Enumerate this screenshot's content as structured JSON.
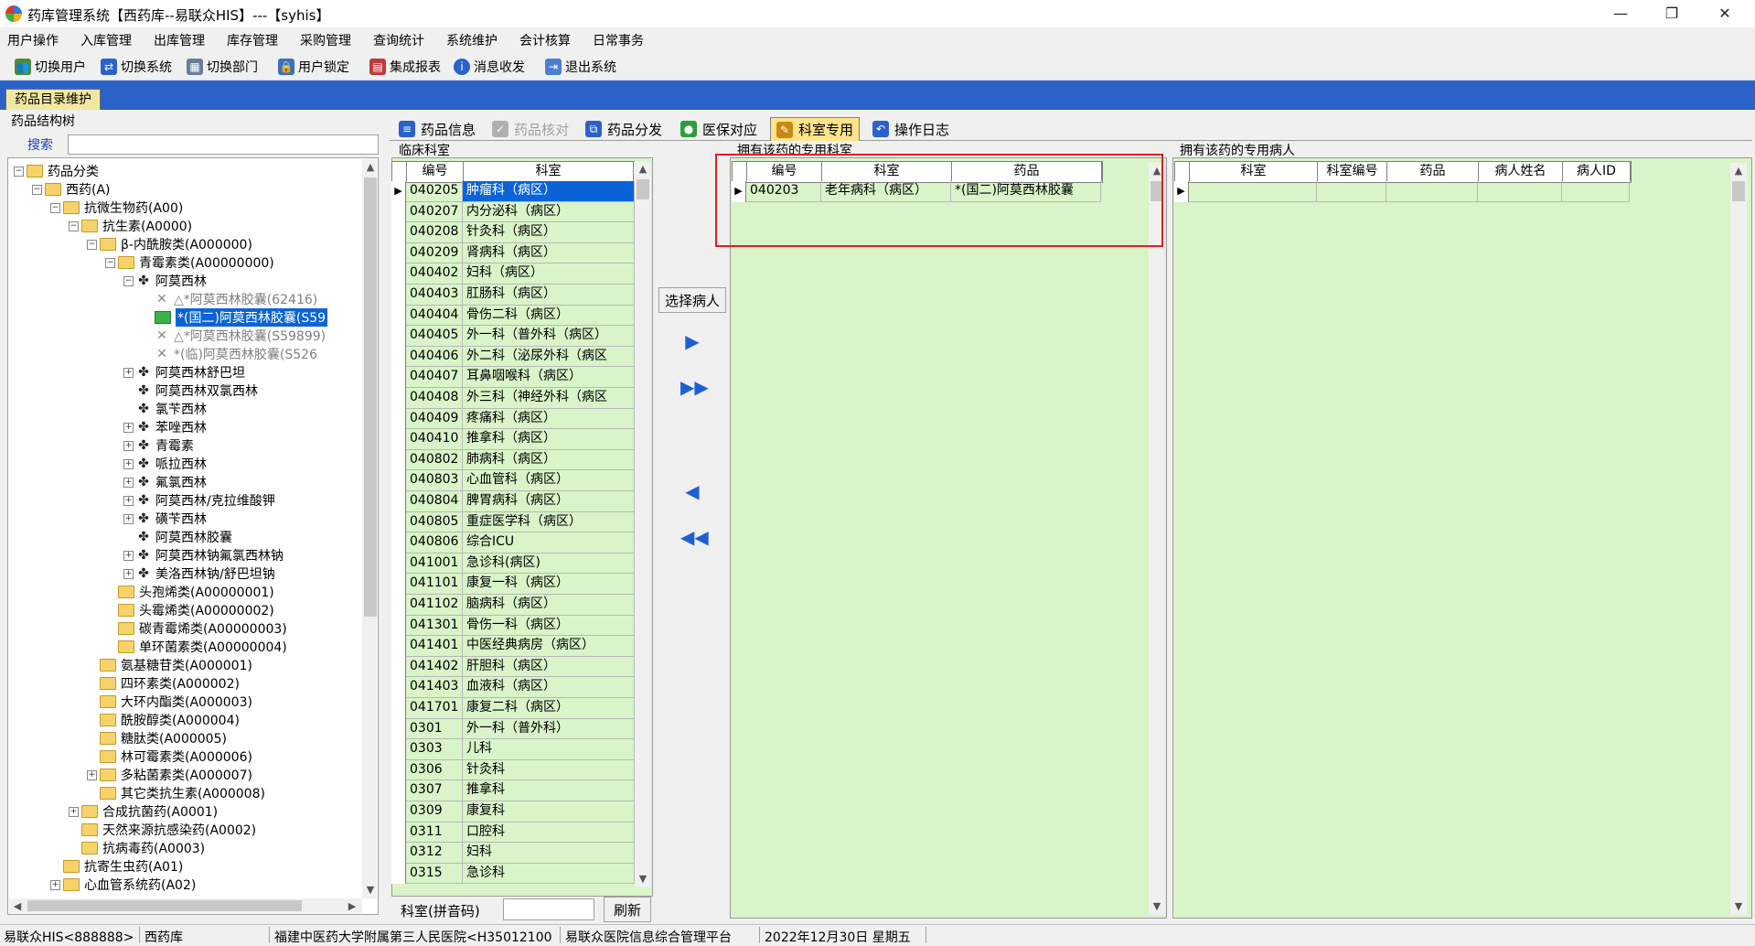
{
  "window": {
    "title": "药库管理系统【西药库--易联众HIS】---【syhis】",
    "minimize": "—",
    "restore": "❐",
    "close": "✕"
  },
  "menu": [
    "用户操作",
    "入库管理",
    "出库管理",
    "库存管理",
    "采购管理",
    "查询统计",
    "系统维护",
    "会计核算",
    "日常事务"
  ],
  "toolbar": [
    "切换用户",
    "切换系统",
    "切换部门",
    "用户锁定",
    "集成报表",
    "消息收发",
    "退出系统"
  ],
  "main_tab": "药品目录维护",
  "tree_panel": {
    "title": "药品结构树",
    "search_label": "搜索",
    "search_value": ""
  },
  "tree": [
    {
      "text": "药品分类",
      "indent": 0,
      "exp": "-",
      "icon": "folder"
    },
    {
      "text": "西药(A)",
      "indent": 1,
      "exp": "-",
      "icon": "folder"
    },
    {
      "text": "抗微生物药(A00)",
      "indent": 2,
      "exp": "-",
      "icon": "folder"
    },
    {
      "text": "抗生素(A0000)",
      "indent": 3,
      "exp": "-",
      "icon": "folder"
    },
    {
      "text": "β-内酰胺类(A000000)",
      "indent": 4,
      "exp": "-",
      "icon": "folder"
    },
    {
      "text": "青霉素类(A00000000)",
      "indent": 5,
      "exp": "-",
      "icon": "folder"
    },
    {
      "text": "阿莫西林",
      "indent": 6,
      "exp": "-",
      "icon": "drug"
    },
    {
      "text": "△*阿莫西林胶囊(62416)",
      "indent": 7,
      "exp": "",
      "icon": "x",
      "style": "grey"
    },
    {
      "text": "*(国二)阿莫西林胶囊(S59",
      "indent": 7,
      "exp": "",
      "icon": "open",
      "style": "sel"
    },
    {
      "text": "△*阿莫西林胶囊(S59899)",
      "indent": 7,
      "exp": "",
      "icon": "x",
      "style": "grey"
    },
    {
      "text": "*(临)阿莫西林胶囊(S526",
      "indent": 7,
      "exp": "",
      "icon": "x",
      "style": "grey"
    },
    {
      "text": "阿莫西林舒巴坦",
      "indent": 6,
      "exp": "+",
      "icon": "drug"
    },
    {
      "text": "阿莫西林双氯西林",
      "indent": 6,
      "exp": "",
      "icon": "drug"
    },
    {
      "text": "氯苄西林",
      "indent": 6,
      "exp": "",
      "icon": "drug"
    },
    {
      "text": "苯唑西林",
      "indent": 6,
      "exp": "+",
      "icon": "drug"
    },
    {
      "text": "青霉素",
      "indent": 6,
      "exp": "+",
      "icon": "drug"
    },
    {
      "text": "哌拉西林",
      "indent": 6,
      "exp": "+",
      "icon": "drug"
    },
    {
      "text": "氟氯西林",
      "indent": 6,
      "exp": "+",
      "icon": "drug"
    },
    {
      "text": "阿莫西林/克拉维酸钾",
      "indent": 6,
      "exp": "+",
      "icon": "drug"
    },
    {
      "text": "磺苄西林",
      "indent": 6,
      "exp": "+",
      "icon": "drug"
    },
    {
      "text": "阿莫西林胶囊",
      "indent": 6,
      "exp": "",
      "icon": "drug"
    },
    {
      "text": "阿莫西林钠氟氯西林钠",
      "indent": 6,
      "exp": "+",
      "icon": "drug"
    },
    {
      "text": "美洛西林钠/舒巴坦钠",
      "indent": 6,
      "exp": "+",
      "icon": "drug"
    },
    {
      "text": "头孢烯类(A00000001)",
      "indent": 5,
      "exp": "",
      "icon": "folder"
    },
    {
      "text": "头霉烯类(A00000002)",
      "indent": 5,
      "exp": "",
      "icon": "folder"
    },
    {
      "text": "碳青霉烯类(A00000003)",
      "indent": 5,
      "exp": "",
      "icon": "folder"
    },
    {
      "text": "单环菌素类(A00000004)",
      "indent": 5,
      "exp": "",
      "icon": "folder"
    },
    {
      "text": "氨基糖苷类(A000001)",
      "indent": 4,
      "exp": "",
      "icon": "folder"
    },
    {
      "text": "四环素类(A000002)",
      "indent": 4,
      "exp": "",
      "icon": "folder"
    },
    {
      "text": "大环内酯类(A000003)",
      "indent": 4,
      "exp": "",
      "icon": "folder"
    },
    {
      "text": "酰胺醇类(A000004)",
      "indent": 4,
      "exp": "",
      "icon": "folder"
    },
    {
      "text": "糖肽类(A000005)",
      "indent": 4,
      "exp": "",
      "icon": "folder"
    },
    {
      "text": "林可霉素类(A000006)",
      "indent": 4,
      "exp": "",
      "icon": "folder"
    },
    {
      "text": "多粘菌素类(A000007)",
      "indent": 4,
      "exp": "+",
      "icon": "folder"
    },
    {
      "text": "其它类抗生素(A000008)",
      "indent": 4,
      "exp": "",
      "icon": "folder"
    },
    {
      "text": "合成抗菌药(A0001)",
      "indent": 3,
      "exp": "+",
      "icon": "folder"
    },
    {
      "text": "天然来源抗感染药(A0002)",
      "indent": 3,
      "exp": "",
      "icon": "folder"
    },
    {
      "text": "抗病毒药(A0003)",
      "indent": 3,
      "exp": "",
      "icon": "folder"
    },
    {
      "text": "抗寄生虫药(A01)",
      "indent": 2,
      "exp": "",
      "icon": "folder"
    },
    {
      "text": "心血管系统药(A02)",
      "indent": 2,
      "exp": "+",
      "icon": "folder"
    }
  ],
  "sub_tabs": [
    {
      "label": "药品信息",
      "state": "normal",
      "icon": "≡",
      "color": "#2b62c9"
    },
    {
      "label": "药品核对",
      "state": "disabled",
      "icon": "✓",
      "color": "#b0b0b0"
    },
    {
      "label": "药品分发",
      "state": "normal",
      "icon": "⧉",
      "color": "#2b62c9"
    },
    {
      "label": "医保对应",
      "state": "normal",
      "icon": "●",
      "color": "#2f9e3a"
    },
    {
      "label": "科室专用",
      "state": "active",
      "icon": "✎",
      "color": "#c88a10"
    },
    {
      "label": "操作日志",
      "state": "normal",
      "icon": "↶",
      "color": "#2b62c9"
    }
  ],
  "clinic_panel": {
    "title": "临床科室",
    "headers": [
      "编号",
      "科室"
    ],
    "rows": [
      [
        "040205",
        "肿瘤科（病区）"
      ],
      [
        "040207",
        "内分泌科（病区）"
      ],
      [
        "040208",
        "针灸科（病区）"
      ],
      [
        "040209",
        "肾病科（病区）"
      ],
      [
        "040402",
        "妇科（病区）"
      ],
      [
        "040403",
        "肛肠科（病区）"
      ],
      [
        "040404",
        "骨伤二科（病区）"
      ],
      [
        "040405",
        "外一科（普外科（病区）"
      ],
      [
        "040406",
        "外二科（泌尿外科（病区"
      ],
      [
        "040407",
        "耳鼻咽喉科（病区）"
      ],
      [
        "040408",
        "外三科（神经外科（病区"
      ],
      [
        "040409",
        "疼痛科（病区）"
      ],
      [
        "040410",
        "推拿科（病区）"
      ],
      [
        "040802",
        "肺病科（病区）"
      ],
      [
        "040803",
        "心血管科（病区）"
      ],
      [
        "040804",
        "脾胃病科（病区）"
      ],
      [
        "040805",
        "重症医学科（病区）"
      ],
      [
        "040806",
        "综合ICU"
      ],
      [
        "041001",
        "急诊科(病区)"
      ],
      [
        "041101",
        "康复一科（病区）"
      ],
      [
        "041102",
        "脑病科（病区）"
      ],
      [
        "041301",
        "骨伤一科（病区）"
      ],
      [
        "041401",
        "中医经典病房（病区）"
      ],
      [
        "041402",
        "肝胆科（病区）"
      ],
      [
        "041403",
        "血液科（病区）"
      ],
      [
        "041701",
        "康复二科（病区）"
      ],
      [
        "0301",
        "外一科（普外科）"
      ],
      [
        "0303",
        "儿科"
      ],
      [
        "0306",
        "针灸科"
      ],
      [
        "0307",
        "推拿科"
      ],
      [
        "0309",
        "康复科"
      ],
      [
        "0311",
        "口腔科"
      ],
      [
        "0312",
        "妇科"
      ],
      [
        "0315",
        "急诊科"
      ]
    ],
    "filter_label": "科室(拼音码)",
    "filter_value": "",
    "refresh_button": "刷新"
  },
  "select_patient_button": "选择病人",
  "dept_panel": {
    "title": "拥有该药的专用科室",
    "headers": [
      "编号",
      "科室",
      "药品"
    ],
    "rows": [
      [
        "040203",
        "老年病科（病区）",
        "*(国二)阿莫西林胶囊"
      ]
    ]
  },
  "patient_panel": {
    "title": "拥有该药的专用病人",
    "headers": [
      "科室",
      "科室编号",
      "药品",
      "病人姓名",
      "病人ID"
    ],
    "rows": []
  },
  "status_bar": [
    "易联众HIS<888888>",
    "西药库",
    "福建中医药大学附属第三人民医院<H35012100",
    "易联众医院信息综合管理平台",
    "2022年12月30日 星期五"
  ]
}
